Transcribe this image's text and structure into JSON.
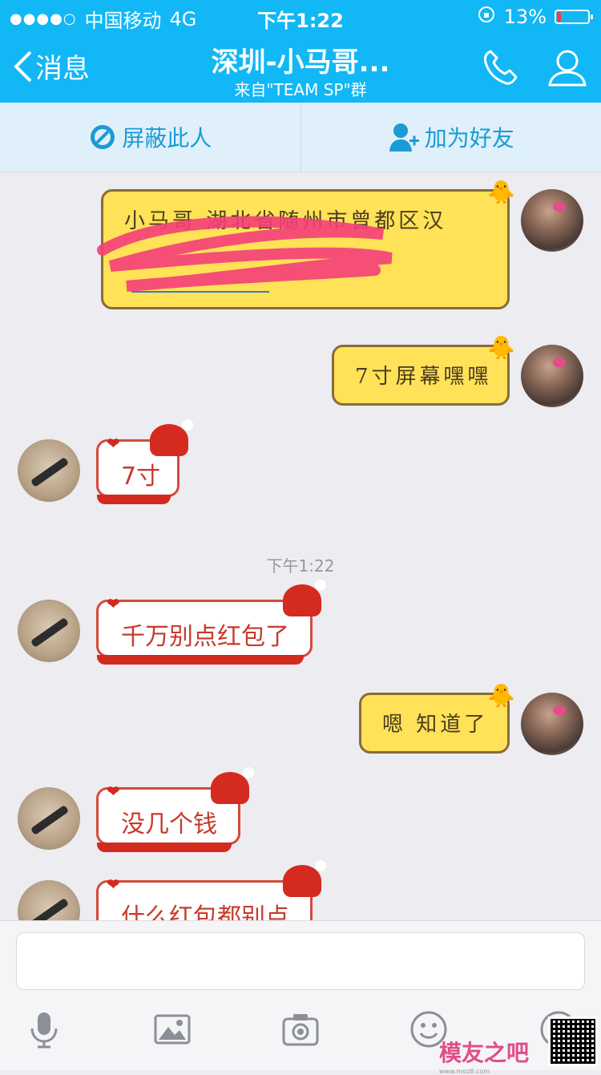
{
  "status_bar": {
    "signal_dots": "●●●●○",
    "carrier": "中国移动",
    "network": "4G",
    "time": "下午1:22",
    "battery_percent": "13%",
    "battery_level": 0.13
  },
  "nav": {
    "back_label": "消息",
    "title": "深圳-小马哥...",
    "subtitle": "来自\"TEAM  SP\"群",
    "phone_icon": "phone-icon",
    "profile_icon": "person-icon"
  },
  "actions": {
    "block_label": "屏蔽此人",
    "add_friend_label": "加为好友"
  },
  "messages": [
    {
      "side": "right",
      "text": "小马哥  湖北省随州市曾都区汉"
    },
    {
      "side": "right",
      "text": "7寸屏幕嘿嘿"
    },
    {
      "side": "left",
      "text": "7寸"
    },
    {
      "side": "left",
      "text": "千万别点红包了"
    },
    {
      "side": "right",
      "text": "嗯 知道了"
    },
    {
      "side": "left",
      "text": "没几个钱"
    },
    {
      "side": "left",
      "text": "什么红包都别点"
    }
  ],
  "timestamp": "下午1:22",
  "input": {
    "placeholder": ""
  },
  "toolbar": [
    "mic-icon",
    "image-icon",
    "camera-icon",
    "emoji-icon",
    "more-icon"
  ],
  "watermark": {
    "text": "模友之吧",
    "url": "www.moz8.com"
  },
  "colors": {
    "accent": "#12b7f5",
    "action_text": "#1a9bd7",
    "background": "#ececf1"
  }
}
